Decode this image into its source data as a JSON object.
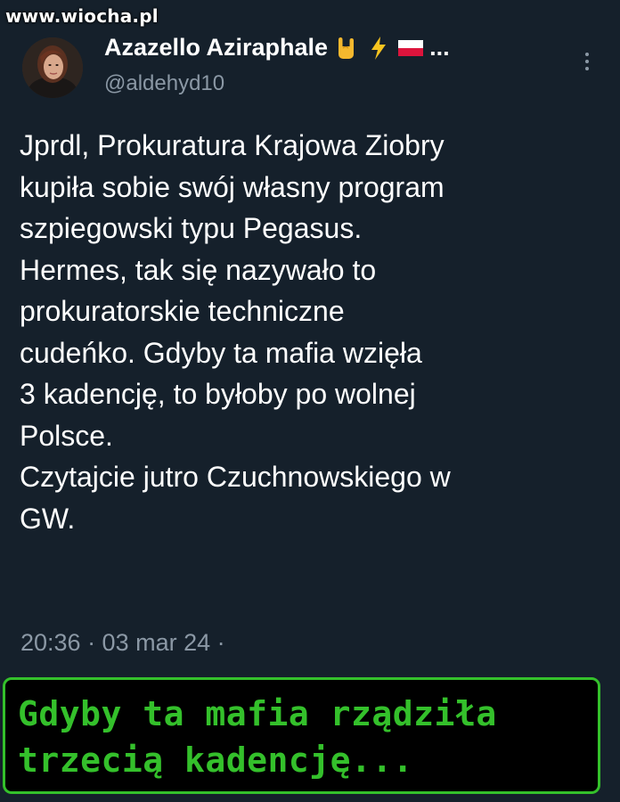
{
  "watermark": "www.wiocha.pl",
  "tweet": {
    "author": {
      "display_name": "Azazello Aziraphale",
      "badges": [
        "rock-hand-emoji",
        "lightning-emoji",
        "poland-flag-emoji"
      ],
      "name_truncation": "...",
      "handle": "@aldehyd10"
    },
    "body_lines": [
      "Jprdl, Prokuratura Krajowa Ziobry",
      "kupiła sobie swój własny program",
      "szpiegowski typu Pegasus.",
      "Hermes, tak się nazywało to",
      "prokuratorskie techniczne",
      "cudeńko. Gdyby ta mafia wzięła",
      "3 kadencję, to byłoby po wolnej",
      "Polsce.",
      "Czytajcie jutro Czuchnowskiego w",
      "GW."
    ],
    "meta": "20:36 · 03 mar 24 ·"
  },
  "caption": {
    "lines": [
      "Gdyby ta mafia rządziła",
      "trzecią kadencję..."
    ]
  },
  "colors": {
    "background": "#15202b",
    "text": "#ffffff",
    "muted": "#8b98a5",
    "caption_green": "#34c02b",
    "caption_bg": "#000000"
  }
}
